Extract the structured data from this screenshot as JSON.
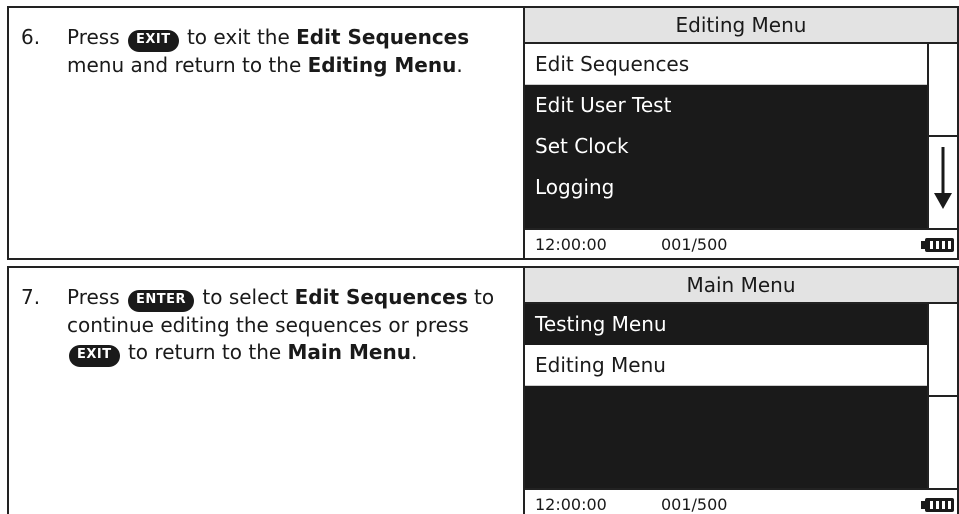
{
  "step6": {
    "number": "6.",
    "text_press": "Press",
    "button": "EXIT",
    "text_1": "to exit the",
    "bold_1": "Edit Sequences",
    "text_2": "menu and return to the",
    "bold_2": "Editing Menu",
    "text_end": ".",
    "screen": {
      "title": "Editing Menu",
      "items": [
        "Edit Sequences",
        "Edit User Test",
        "Set Clock",
        "Logging"
      ],
      "selected_index": 0,
      "time": "12:00:00",
      "count": "001/500"
    }
  },
  "step7": {
    "number": "7.",
    "text_press": "Press",
    "button_enter": "ENTER",
    "text_1": "to select",
    "bold_1": "Edit Sequences",
    "text_2": "to continue editing the sequences or press",
    "button_exit": "EXIT",
    "text_3": "to return to the",
    "bold_2": "Main Menu",
    "text_end": ".",
    "screen": {
      "title": "Main Menu",
      "items": [
        "Testing Menu",
        "Editing Menu"
      ],
      "selected_index": 1,
      "time": "12:00:00",
      "count": "001/500"
    }
  }
}
